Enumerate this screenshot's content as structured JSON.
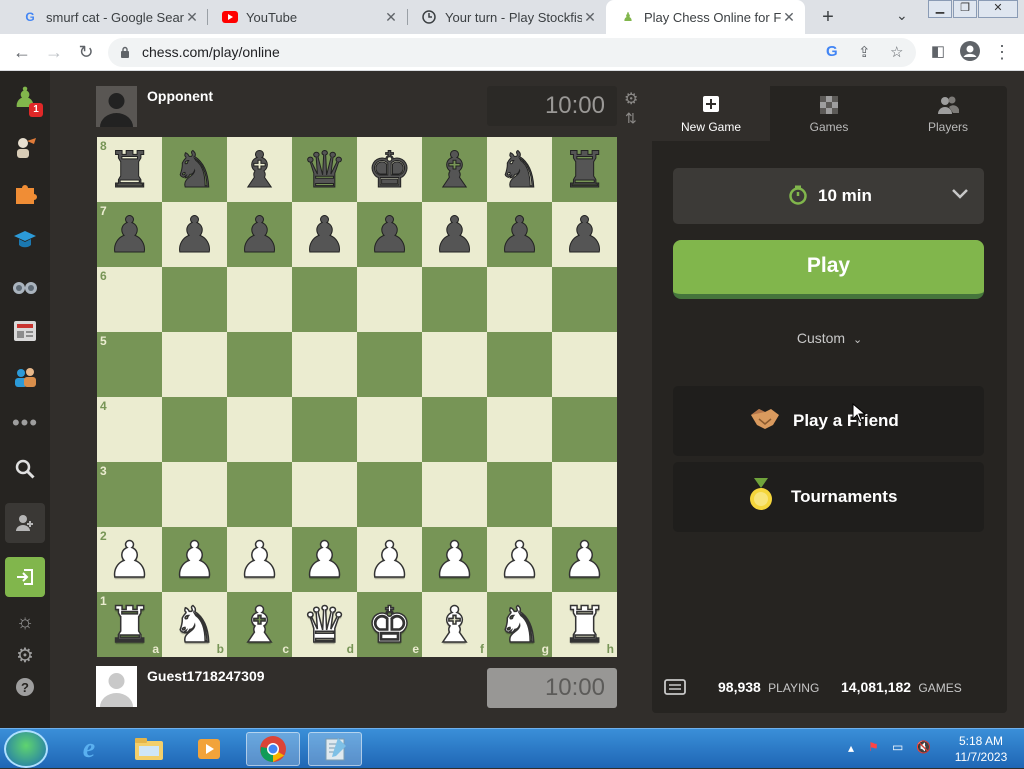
{
  "browser": {
    "tabs": [
      {
        "title": "smurf cat - Google Search",
        "icon": "google-g-icon"
      },
      {
        "title": "YouTube",
        "icon": "youtube-icon"
      },
      {
        "title": "Your turn - Play Stockfish",
        "icon": "stockfish-clock-icon"
      },
      {
        "title": "Play Chess Online for FREE",
        "icon": "chess-pawn-icon",
        "active": true
      }
    ],
    "url": "chess.com/play/online",
    "window_buttons": [
      "minimize",
      "restore",
      "close"
    ]
  },
  "sidebar": {
    "notification_count": "1",
    "items": [
      "home-pawn",
      "lessons",
      "puzzles",
      "learn",
      "watch",
      "news",
      "social",
      "more",
      "search",
      "add-friend",
      "login",
      "theme",
      "settings",
      "help"
    ]
  },
  "game": {
    "opponent": {
      "name": "Opponent",
      "clock": "10:00"
    },
    "player": {
      "name": "Guest1718247309",
      "clock": "10:00"
    },
    "ranks": [
      "8",
      "7",
      "6",
      "5",
      "4",
      "3",
      "2",
      "1"
    ],
    "files": [
      "a",
      "b",
      "c",
      "d",
      "e",
      "f",
      "g",
      "h"
    ],
    "position": [
      [
        "br",
        "bn",
        "bb",
        "bq",
        "bk",
        "bb",
        "bn",
        "br"
      ],
      [
        "bp",
        "bp",
        "bp",
        "bp",
        "bp",
        "bp",
        "bp",
        "bp"
      ],
      [
        "",
        "",
        "",
        "",
        "",
        "",
        "",
        ""
      ],
      [
        "",
        "",
        "",
        "",
        "",
        "",
        "",
        ""
      ],
      [
        "",
        "",
        "",
        "",
        "",
        "",
        "",
        ""
      ],
      [
        "",
        "",
        "",
        "",
        "",
        "",
        "",
        ""
      ],
      [
        "wp",
        "wp",
        "wp",
        "wp",
        "wp",
        "wp",
        "wp",
        "wp"
      ],
      [
        "wr",
        "wn",
        "wb",
        "wq",
        "wk",
        "wb",
        "wn",
        "wr"
      ]
    ]
  },
  "panel": {
    "tabs": [
      {
        "label": "New Game",
        "icon": "plus-square-icon"
      },
      {
        "label": "Games",
        "icon": "checker-icon"
      },
      {
        "label": "Players",
        "icon": "players-icon"
      }
    ],
    "time_control": "10 min",
    "play_label": "Play",
    "custom_label": "Custom",
    "play_friend_label": "Play a Friend",
    "tournaments_label": "Tournaments",
    "stats": {
      "playing_count": "98,938",
      "playing_label": "PLAYING",
      "games_count": "14,081,182",
      "games_label": "GAMES"
    }
  },
  "taskbar": {
    "time": "5:18 AM",
    "date": "11/7/2023",
    "apps": [
      "internet-explorer",
      "file-explorer",
      "media-player",
      "chrome",
      "notepad"
    ]
  },
  "colors": {
    "board_light": "#ebecd0",
    "board_dark": "#779556",
    "play_green": "#81b64c",
    "page_bg": "#312e2b"
  }
}
